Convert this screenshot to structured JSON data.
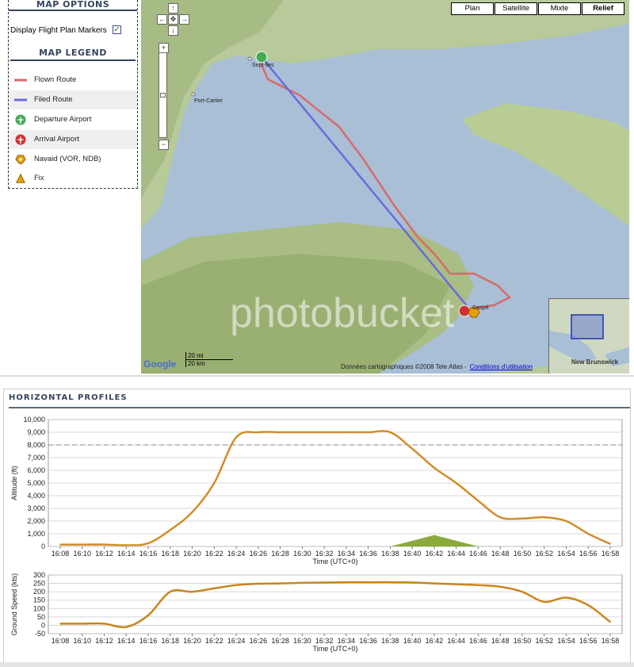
{
  "options": {
    "title": "MAP OPTIONS",
    "flight_plan_markers_label": "Display Flight Plan Markers",
    "flight_plan_markers_checked": true,
    "legend_title": "MAP LEGEND",
    "legend": [
      {
        "label": "Flown Route",
        "icon": "red-line-icon",
        "color": "#d9696b"
      },
      {
        "label": "Filed Route",
        "icon": "blue-line-icon",
        "color": "#6b6bdb"
      },
      {
        "label": "Departure Airport",
        "icon": "green-plane-icon",
        "color": "#44aa55"
      },
      {
        "label": "Arrival Airport",
        "icon": "red-plane-icon",
        "color": "#cc3333"
      },
      {
        "label": "Navaid (VOR, NDB)",
        "icon": "navaid-icon",
        "color": "#e8a000"
      },
      {
        "label": "Fix",
        "icon": "fix-triangle-icon",
        "color": "#e8a000"
      }
    ]
  },
  "map": {
    "map_types": [
      "Plan",
      "Satellite",
      "Mixte",
      "Relief"
    ],
    "selected_type": "Relief",
    "city_labels": [
      "Sept-Îles",
      "Port-Cartier",
      "Gaspé"
    ],
    "scale_top": "20 mi",
    "scale_bottom": "20 km",
    "copyright": "Données cartographiques ©2008 Tele Atlas -",
    "terms_link": "Conditions d'utilisation",
    "overview_label": "New Brunswick",
    "google_logo": "Google",
    "watermark": "photobucket"
  },
  "profiles": {
    "title": "HORIZONTAL PROFILES"
  },
  "chart_data": [
    {
      "type": "line",
      "title": "",
      "xlabel": "Time (UTC+0)",
      "ylabel": "Altitude (ft)",
      "ylim": [
        0,
        10000
      ],
      "yticks": [
        "0",
        "1,000",
        "2,000",
        "3,000",
        "4,000",
        "5,000",
        "6,000",
        "7,000",
        "8,000",
        "9,000",
        "10,000"
      ],
      "categories": [
        "16:08",
        "16:10",
        "16:12",
        "16:14",
        "16:16",
        "16:18",
        "16:20",
        "16:22",
        "16:24",
        "16:26",
        "16:28",
        "16:30",
        "16:32",
        "16:34",
        "16:36",
        "16:38",
        "16:40",
        "16:42",
        "16:44",
        "16:46",
        "16:48",
        "16:50",
        "16:52",
        "16:54",
        "16:56",
        "16:58"
      ],
      "series": [
        {
          "values": [
            150,
            150,
            150,
            100,
            250,
            1300,
            2700,
            5000,
            8600,
            9000,
            9000,
            9000,
            9000,
            9000,
            9000,
            9000,
            7700,
            6200,
            5000,
            3600,
            2300,
            2200,
            2300,
            2000,
            1000,
            200
          ]
        }
      ],
      "grid": true,
      "reference_line": 8000,
      "terrain": [
        {
          "start": "16:38",
          "peak": "16:42",
          "end": "16:46",
          "height": 900
        }
      ],
      "colors": {
        "line": "#c8861f",
        "line_light": "#f2c790",
        "terrain": "#8aaa3c"
      }
    },
    {
      "type": "line",
      "title": "",
      "xlabel": "Time (UTC+0)",
      "ylabel": "Ground Speed (kts)",
      "ylim": [
        -50,
        300
      ],
      "yticks": [
        "-50",
        "0",
        "50",
        "100",
        "150",
        "200",
        "250",
        "300"
      ],
      "categories": [
        "16:08",
        "16:10",
        "16:12",
        "16:14",
        "16:16",
        "16:18",
        "16:20",
        "16:22",
        "16:24",
        "16:26",
        "16:28",
        "16:30",
        "16:32",
        "16:34",
        "16:36",
        "16:38",
        "16:40",
        "16:42",
        "16:44",
        "16:46",
        "16:48",
        "16:50",
        "16:52",
        "16:54",
        "16:56",
        "16:58"
      ],
      "series": [
        {
          "values": [
            10,
            10,
            10,
            -10,
            60,
            200,
            200,
            220,
            240,
            248,
            250,
            253,
            255,
            257,
            257,
            257,
            255,
            250,
            245,
            240,
            230,
            200,
            140,
            165,
            120,
            20
          ]
        }
      ],
      "grid": true,
      "colors": {
        "line": "#c8861f"
      }
    }
  ]
}
